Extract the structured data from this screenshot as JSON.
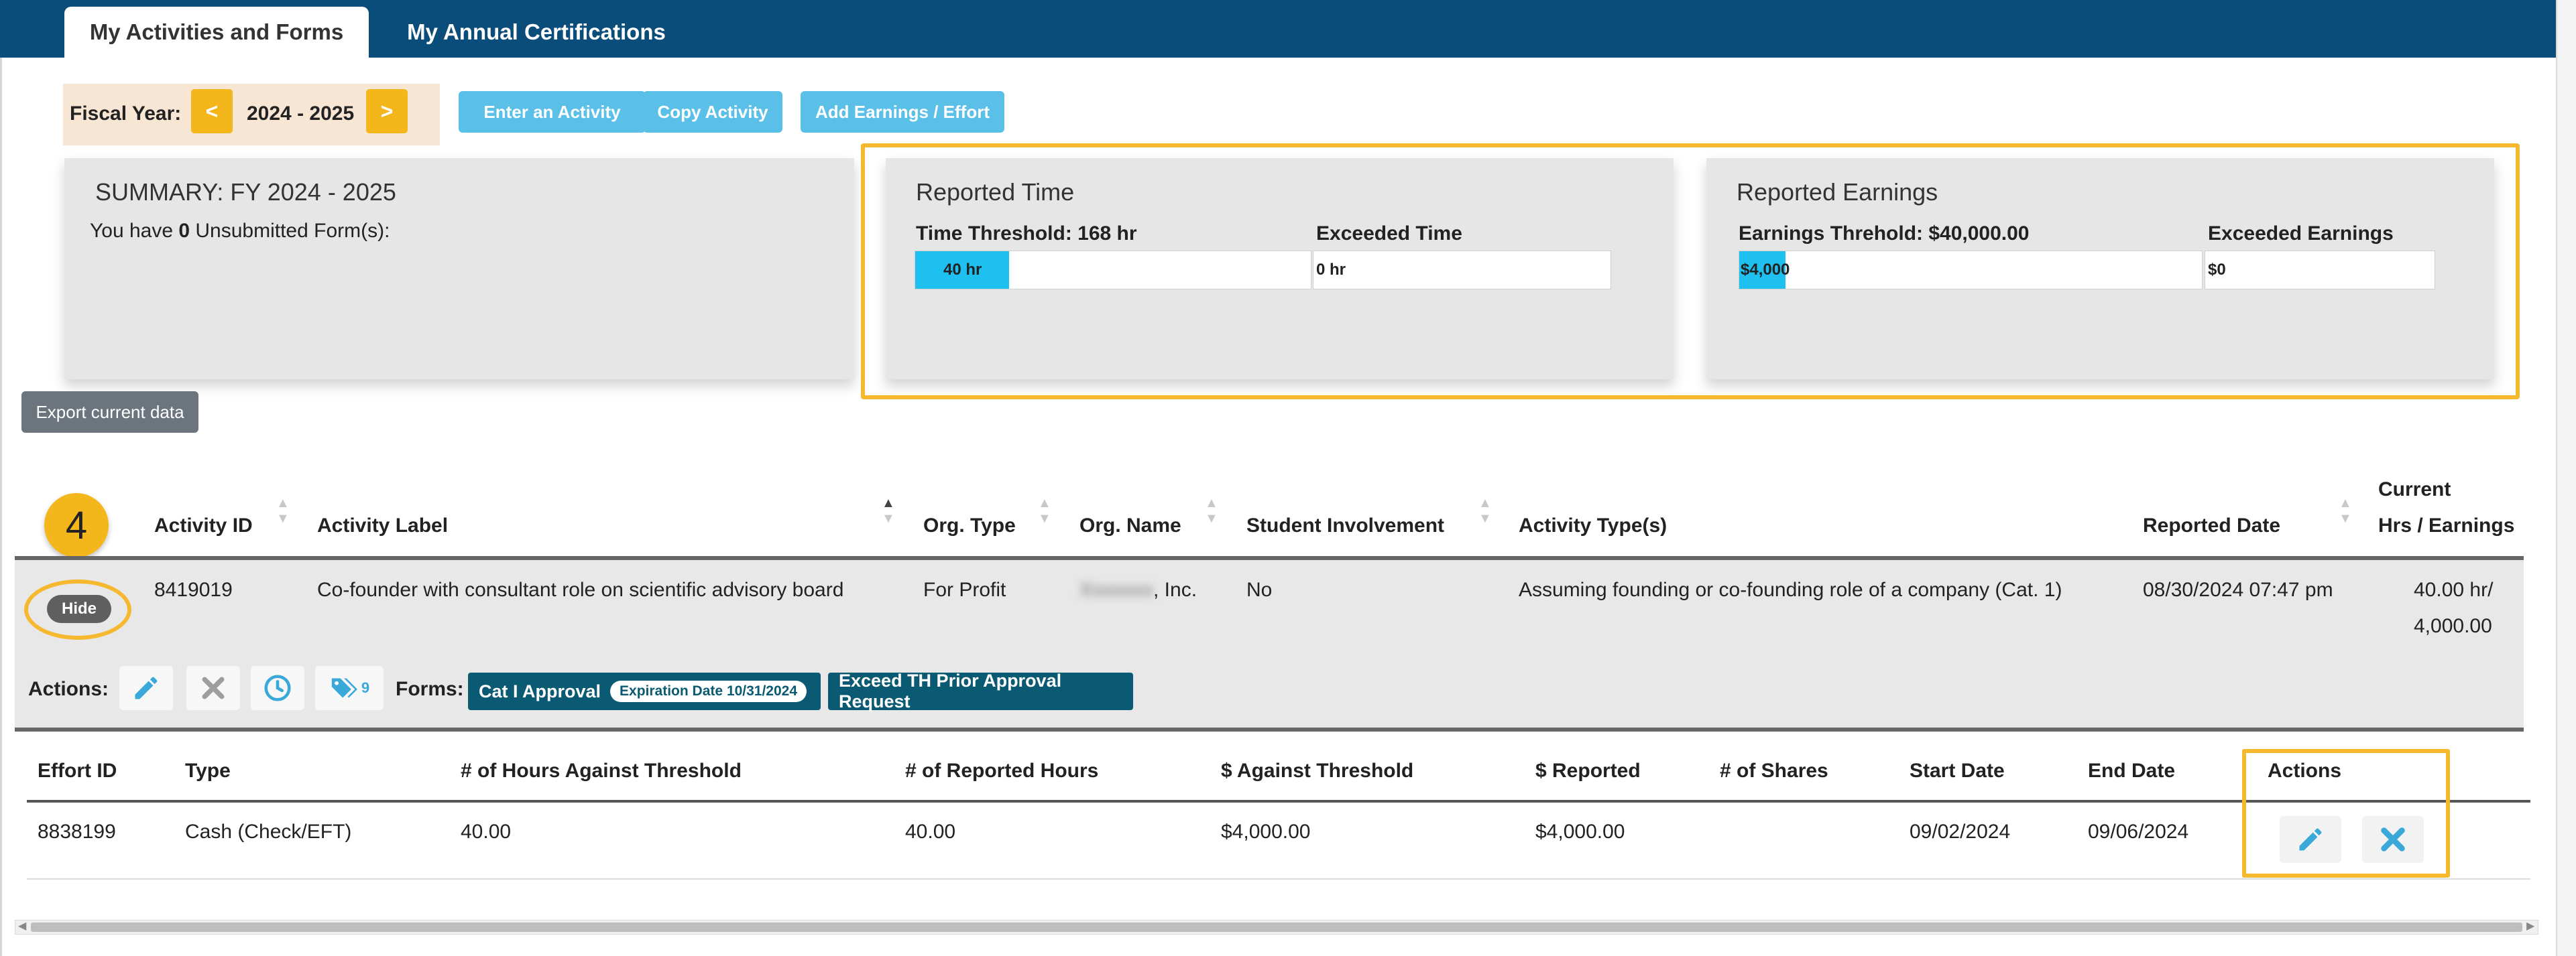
{
  "tabs": [
    {
      "label": "My Activities and Forms",
      "active": true
    },
    {
      "label": "My Annual Certifications",
      "active": false
    }
  ],
  "fiscal_year": {
    "label": "Fiscal Year:",
    "prev": "<",
    "value": "2024 - 2025",
    "next": ">"
  },
  "toolbar": {
    "enter_activity": "Enter an Activity",
    "copy_activity": "Copy Activity",
    "add_earnings": "Add Earnings / Effort"
  },
  "summary": {
    "title": "SUMMARY: FY 2024 - 2025",
    "text_prefix": "You have ",
    "count": "0",
    "text_suffix": " Unsubmitted Form(s):"
  },
  "reported_time": {
    "title": "Reported Time",
    "threshold_label": "Time Threshold: 168 hr",
    "exceeded_label": "Exceeded Time",
    "bar_value": "40 hr",
    "bar_fraction": 0.238,
    "exceeded_value": "0 hr"
  },
  "reported_earnings": {
    "title": "Reported Earnings",
    "threshold_label": "Earnings Threhold: $40,000.00",
    "exceeded_label": "Exceeded Earnings",
    "bar_value": "$4,000",
    "bar_fraction": 0.1,
    "exceeded_value": "$0"
  },
  "export_button": "Export current data",
  "step_marker": "4",
  "activity_table": {
    "headers": {
      "activity_id": "Activity ID",
      "activity_label": "Activity Label",
      "org_type": "Org. Type",
      "org_name": "Org. Name",
      "student_involvement": "Student Involvement",
      "activity_types": "Activity Type(s)",
      "reported_date": "Reported Date",
      "current_line1": "Current",
      "current_line2": "Hrs / Earnings"
    },
    "row": {
      "hide": "Hide",
      "activity_id": "8419019",
      "activity_label": "Co-founder with consultant role on scientific advisory board",
      "org_type": "For Profit",
      "org_name_redacted": "Xxxxxxx",
      "org_name_suffix": ", Inc.",
      "student_involvement": "No",
      "activity_types": "Assuming founding or co-founding role of a company (Cat. 1)",
      "reported_date": "08/30/2024 07:47 pm",
      "current_line1": "40.00 hr/",
      "current_line2": "4,000.00"
    },
    "actions_label": "Actions:",
    "tag_count": "9",
    "forms_label": "Forms:",
    "form_cat1": "Cat I Approval",
    "form_cat1_expiration": "Expiration Date 10/31/2024",
    "form_exceed": "Exceed TH Prior Approval Request"
  },
  "effort_table": {
    "headers": [
      "Effort ID",
      "Type",
      "# of Hours Against Threshold",
      "# of Reported Hours",
      "$ Against Threshold",
      "$ Reported",
      "# of Shares",
      "Start Date",
      "End Date",
      "Actions"
    ],
    "row": [
      "8838199",
      "Cash (Check/EFT)",
      "40.00",
      "40.00",
      "$4,000.00",
      "$4,000.00",
      "",
      "09/02/2024",
      "09/06/2024"
    ]
  },
  "colors": {
    "banner": "#0a4d7a",
    "accent_blue": "#5bc0e8",
    "highlight": "#f5b82e",
    "progress": "#1ec0ef",
    "form_button": "#0a5a73"
  }
}
